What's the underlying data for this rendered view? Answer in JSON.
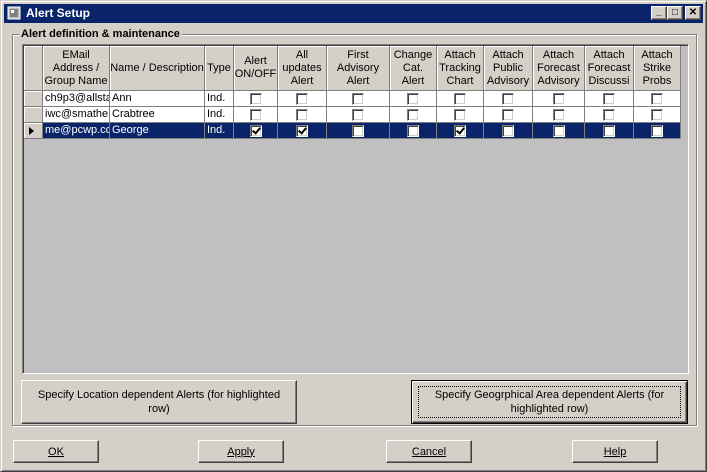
{
  "window": {
    "title": "Alert Setup",
    "controls": {
      "minimize": "_",
      "maximize": "□",
      "close": "✕"
    }
  },
  "group": {
    "title": "Alert definition & maintenance"
  },
  "grid": {
    "columns": [
      "EMail\nAddress /\nGroup Name",
      "Name / Description",
      "Type",
      "Alert\nON/OFF",
      "All\nupdates\nAlert",
      "First\nAdvisory\nAlert",
      "Change\nCat.\nAlert",
      "Attach\nTracking\nChart",
      "Attach\nPublic\nAdvisory",
      "Attach\nForecast\nAdvisory",
      "Attach\nForecast\nDiscussi",
      "Attach\nStrike\nProbs"
    ],
    "rows": [
      {
        "email": "ch9p3@allsta",
        "name": "Ann",
        "type": "Ind.",
        "flags": [
          false,
          false,
          false,
          false,
          false,
          false,
          false,
          false,
          false
        ]
      },
      {
        "email": "iwc@smathe",
        "name": "Crabtree",
        "type": "Ind.",
        "flags": [
          false,
          false,
          false,
          false,
          false,
          false,
          false,
          false,
          false
        ]
      },
      {
        "email": "me@pcwp.cc",
        "name": "George",
        "type": "Ind.",
        "flags": [
          true,
          true,
          false,
          false,
          true,
          false,
          false,
          false,
          false
        ],
        "selected": true
      }
    ]
  },
  "buttons": {
    "location_alerts": "Specify Location dependent Alerts (for highlighted row)",
    "area_alerts": "Specify Geogrphical Area dependent Alerts (for highlighted row)",
    "ok": "OK",
    "apply": "Apply",
    "cancel": "Cancel",
    "help": "Help"
  },
  "colors": {
    "selection": "#0a246a",
    "face": "#d4d0c8",
    "grid_bg": "#c0c0c0"
  }
}
